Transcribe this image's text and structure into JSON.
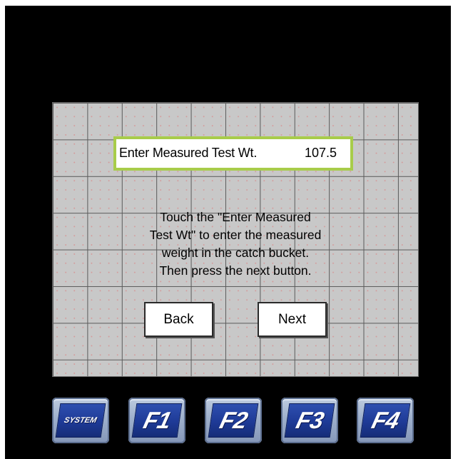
{
  "entry": {
    "label": "Enter Measured Test Wt.",
    "value": "107.5"
  },
  "instructions": [
    "Touch the \"Enter Measured",
    "Test Wt\" to enter the measured",
    "weight in the catch bucket.",
    "Then press the next button."
  ],
  "buttons": {
    "back": "Back",
    "next": "Next"
  },
  "function_keys": [
    {
      "label": "SYSTEM",
      "icon": "system-key"
    },
    {
      "label": "F1",
      "icon": "f1-key"
    },
    {
      "label": "F2",
      "icon": "f2-key"
    },
    {
      "label": "F3",
      "icon": "f3-key"
    },
    {
      "label": "F4",
      "icon": "f4-key"
    }
  ],
  "colors": {
    "bezel": "#000000",
    "screen_background": "#c8c8c8",
    "entry_border": "#a8cc4a",
    "key_face": "#1e3a96"
  }
}
